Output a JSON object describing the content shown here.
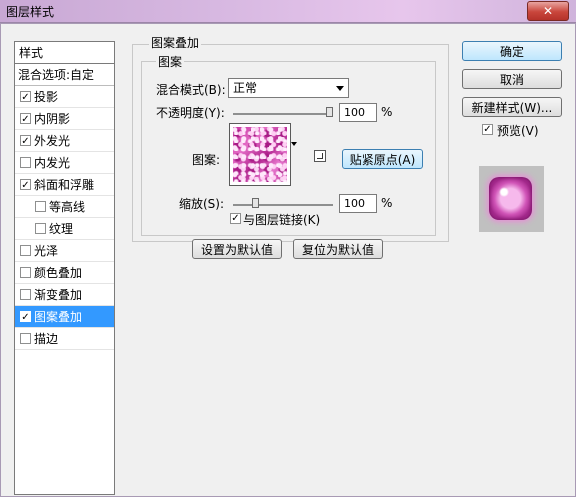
{
  "window": {
    "title": "图层样式"
  },
  "left_panel": {
    "header": "样式",
    "blend_options": "混合选项:自定",
    "items": [
      {
        "label": "投影",
        "checked": true,
        "indent": false,
        "selected": false
      },
      {
        "label": "内阴影",
        "checked": true,
        "indent": false,
        "selected": false
      },
      {
        "label": "外发光",
        "checked": true,
        "indent": false,
        "selected": false
      },
      {
        "label": "内发光",
        "checked": false,
        "indent": false,
        "selected": false
      },
      {
        "label": "斜面和浮雕",
        "checked": true,
        "indent": false,
        "selected": false
      },
      {
        "label": "等高线",
        "checked": false,
        "indent": true,
        "selected": false
      },
      {
        "label": "纹理",
        "checked": false,
        "indent": true,
        "selected": false
      },
      {
        "label": "光泽",
        "checked": false,
        "indent": false,
        "selected": false
      },
      {
        "label": "颜色叠加",
        "checked": false,
        "indent": false,
        "selected": false
      },
      {
        "label": "渐变叠加",
        "checked": false,
        "indent": false,
        "selected": false
      },
      {
        "label": "图案叠加",
        "checked": true,
        "indent": false,
        "selected": true
      },
      {
        "label": "描边",
        "checked": false,
        "indent": false,
        "selected": false
      }
    ]
  },
  "pattern_overlay": {
    "group_title": "图案叠加",
    "sub_title": "图案",
    "blend_mode_label": "混合模式(B):",
    "blend_mode_value": "正常",
    "opacity_label": "不透明度(Y):",
    "opacity_value": "100",
    "opacity_unit": "%",
    "opacity_level": 1.0,
    "pattern_label": "图案:",
    "snap_origin_button": "贴紧原点(A)",
    "scale_label": "缩放(S):",
    "scale_value": "100",
    "scale_unit": "%",
    "scale_level": 0.2,
    "link_label": "与图层链接(K)",
    "link_checked": true,
    "set_default_button": "设置为默认值",
    "reset_default_button": "复位为默认值"
  },
  "right_panel": {
    "ok_button": "确定",
    "cancel_button": "取消",
    "new_style_button": "新建样式(W)...",
    "preview_label": "预览(V)",
    "preview_checked": true
  },
  "colors": {
    "selected_bg": "#3399ff",
    "pattern_pink": "#d04bb1",
    "titlebar": "#d8b9e2",
    "close_button": "#c9463c"
  },
  "checkmark": "✓",
  "close_glyph": "✕",
  "icons": [
    "close-icon",
    "dropdown-arrow-icon",
    "new-preset-icon"
  ]
}
